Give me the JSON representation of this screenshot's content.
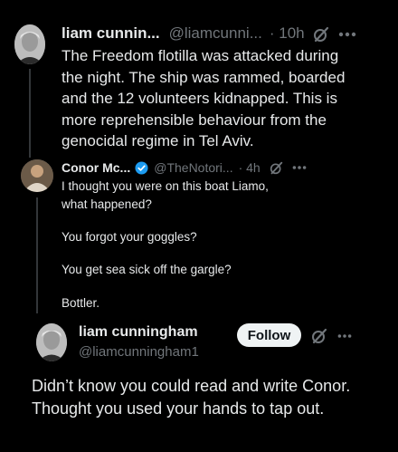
{
  "tweet1": {
    "name": "liam cunnin...",
    "handle": "@liamcunni...",
    "time": "· 10h",
    "body": "The Freedom flotilla was attacked during the night. The ship was rammed, boarded and the 12 volunteers kidnapped. This is more reprehensible behaviour from the genocidal regime in Tel Aviv."
  },
  "tweet2": {
    "name": "Conor Mc...",
    "handle": "@TheNotori...",
    "time": "· 4h",
    "lines": [
      "I thought you were on this boat Liamo,",
      "what happened?",
      "You forgot your goggles?",
      "You get sea sick off the gargle?",
      "Bottler."
    ]
  },
  "tweet3": {
    "name": "liam cunningham",
    "handle": "@liamcunningham1",
    "follow_label": "Follow",
    "body": "Didn’t know you could read and write Conor. Thought you used your hands to tap out."
  },
  "icons": {
    "grok": "grok-icon",
    "more": "more-icon",
    "verified": "verified-badge-icon"
  },
  "colors": {
    "background": "#000000",
    "text": "#e7e9ea",
    "muted": "#71767b",
    "verified": "#1d9bf0",
    "follow_bg": "#eff3f4"
  }
}
